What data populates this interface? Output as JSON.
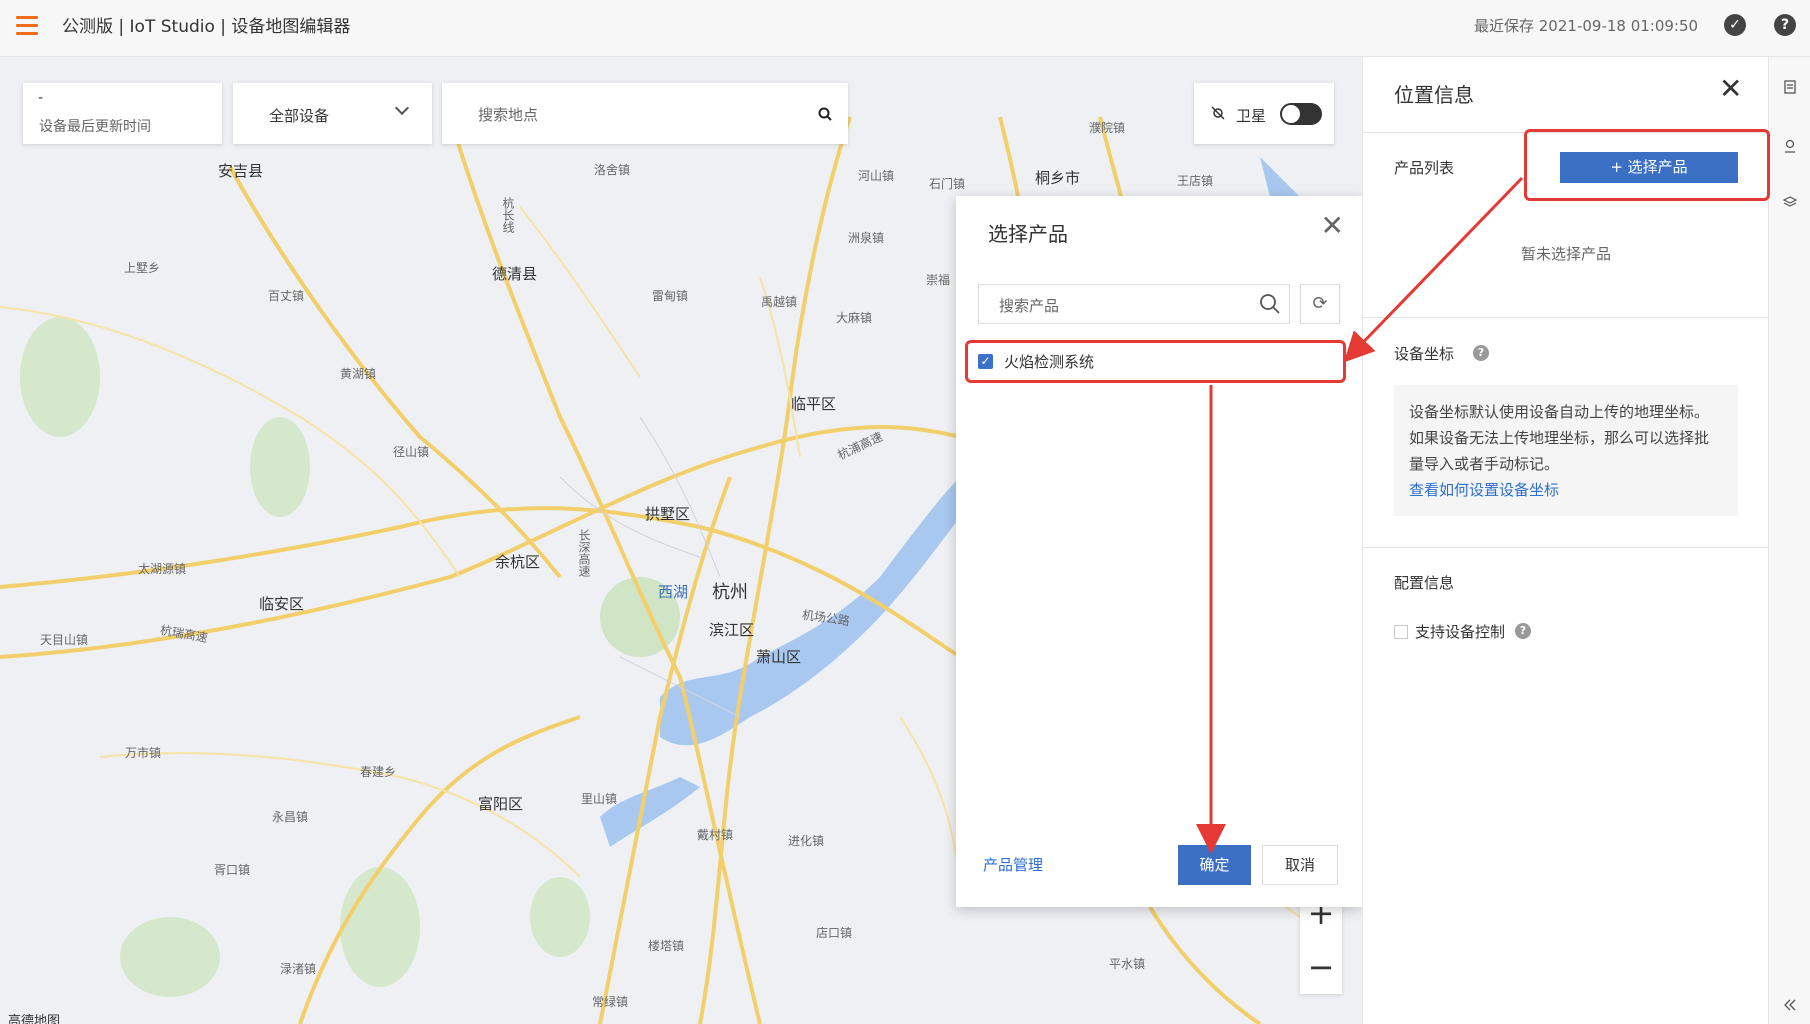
{
  "header": {
    "title": "公测版 | IoT Studio | 设备地图编辑器",
    "last_saved": "最近保存 2021-09-18 01:09:50"
  },
  "map": {
    "time_card": {
      "value": "-",
      "label": "设备最后更新时间"
    },
    "device_select": {
      "value": "全部设备"
    },
    "search_place": {
      "placeholder": "搜索地点"
    },
    "satellite": {
      "label": "卫星",
      "enabled": false
    },
    "zoom": {
      "in": "+",
      "out": "−"
    },
    "provider": "高德地图",
    "labels": [
      "安吉县",
      "洛舍镇",
      "河山镇",
      "石门镇",
      "桐乡市",
      "王店镇",
      "濮院镇",
      "上墅乡",
      "百丈镇",
      "德清县",
      "雷甸镇",
      "禹越镇",
      "洲泉镇",
      "大麻镇",
      "崇福",
      "黄湖镇",
      "临平区",
      "径山镇",
      "拱墅区",
      "余杭区",
      "太湖源镇",
      "临安区",
      "天目山镇",
      "西湖",
      "杭州",
      "滨江区",
      "萧山区",
      "万市镇",
      "春建乡",
      "富阳区",
      "里山镇",
      "永昌镇",
      "戴村镇",
      "进化镇",
      "胥口镇",
      "店口镇",
      "楼塔镇",
      "渌渚镇",
      "常绿镇",
      "平水镇",
      "杭瑞高速",
      "杭浦高速",
      "杭长线",
      "机场公路",
      "长深高速"
    ]
  },
  "dialog": {
    "title": "选择产品",
    "search_placeholder": "搜索产品",
    "products": [
      {
        "name": "火焰检测系统",
        "checked": true
      }
    ],
    "manage_link": "产品管理",
    "ok": "确定",
    "cancel": "取消"
  },
  "panel": {
    "title": "位置信息",
    "product_list_label": "产品列表",
    "select_product_button": "+ 选择产品",
    "empty_text": "暂未选择产品",
    "coords_label": "设备坐标",
    "coords_info": "设备坐标默认使用设备自动上传的地理坐标。如果设备无法上传地理坐标，那么可以选择批量导入或者手动标记。",
    "coords_link": "查看如何设置设备坐标",
    "config_label": "配置信息",
    "device_control_label": "支持设备控制"
  },
  "colors": {
    "accent": "#3a6fc4",
    "link": "#2c6fd1",
    "annotation": "#e53935",
    "menu": "#f26a1b"
  }
}
